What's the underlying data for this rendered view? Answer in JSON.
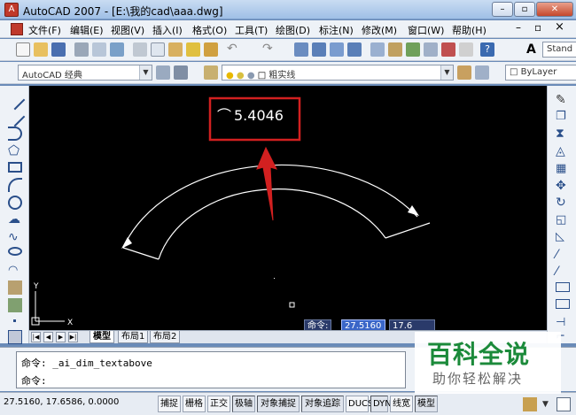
{
  "window": {
    "title": "AutoCAD 2007 - [E:\\我的cad\\aaa.dwg]",
    "minimize_glyph": "–",
    "maximize_glyph": "▫",
    "close_glyph": "✕",
    "doc_minimize_glyph": "–",
    "doc_restore_glyph": "▫",
    "doc_close_glyph": "×"
  },
  "menu": [
    {
      "label": "文件(F)"
    },
    {
      "label": "编辑(E)"
    },
    {
      "label": "视图(V)"
    },
    {
      "label": "插入(I)"
    },
    {
      "label": "格式(O)"
    },
    {
      "label": "工具(T)"
    },
    {
      "label": "绘图(D)"
    },
    {
      "label": "标注(N)"
    },
    {
      "label": "修改(M)"
    },
    {
      "label": "窗口(W)"
    },
    {
      "label": "帮助(H)"
    }
  ],
  "toolbar": {
    "text_style_value": "Stand",
    "workspace_value": "AutoCAD 经典",
    "layer_value": "粗实线",
    "color_value": "ByLayer"
  },
  "drawing": {
    "dimension_text": "5.4046",
    "arc_symbol": "⌒",
    "highlight_color": "#d22020",
    "ucs_x": "X",
    "ucs_y": "Y"
  },
  "dynamic_input": {
    "label": "命令:",
    "x_value": "27.5160",
    "y_value": "17.6"
  },
  "layout_tabs": [
    {
      "label": "模型",
      "active": true
    },
    {
      "label": "布局1",
      "active": false
    },
    {
      "label": "布局2",
      "active": false
    }
  ],
  "command_window": {
    "line1": "命令: _ai_dim_textabove",
    "line2": "命令:"
  },
  "status": {
    "coordinates": "27.5160, 17.6586, 0.0000",
    "buttons": [
      {
        "label": "捕捉",
        "on": false
      },
      {
        "label": "栅格",
        "on": false
      },
      {
        "label": "正交",
        "on": false
      },
      {
        "label": "极轴",
        "on": true
      },
      {
        "label": "对象捕捉",
        "on": true
      },
      {
        "label": "对象追踪",
        "on": true
      },
      {
        "label": "DUCS",
        "on": false
      },
      {
        "label": "DYN",
        "on": true
      },
      {
        "label": "线宽",
        "on": false
      },
      {
        "label": "模型",
        "on": true
      }
    ]
  },
  "watermark": {
    "title": "百科全说",
    "subtitle": "助你轻松解决"
  },
  "colors": {
    "canvas": "#000000",
    "watermark_green": "#1b8a3a"
  }
}
